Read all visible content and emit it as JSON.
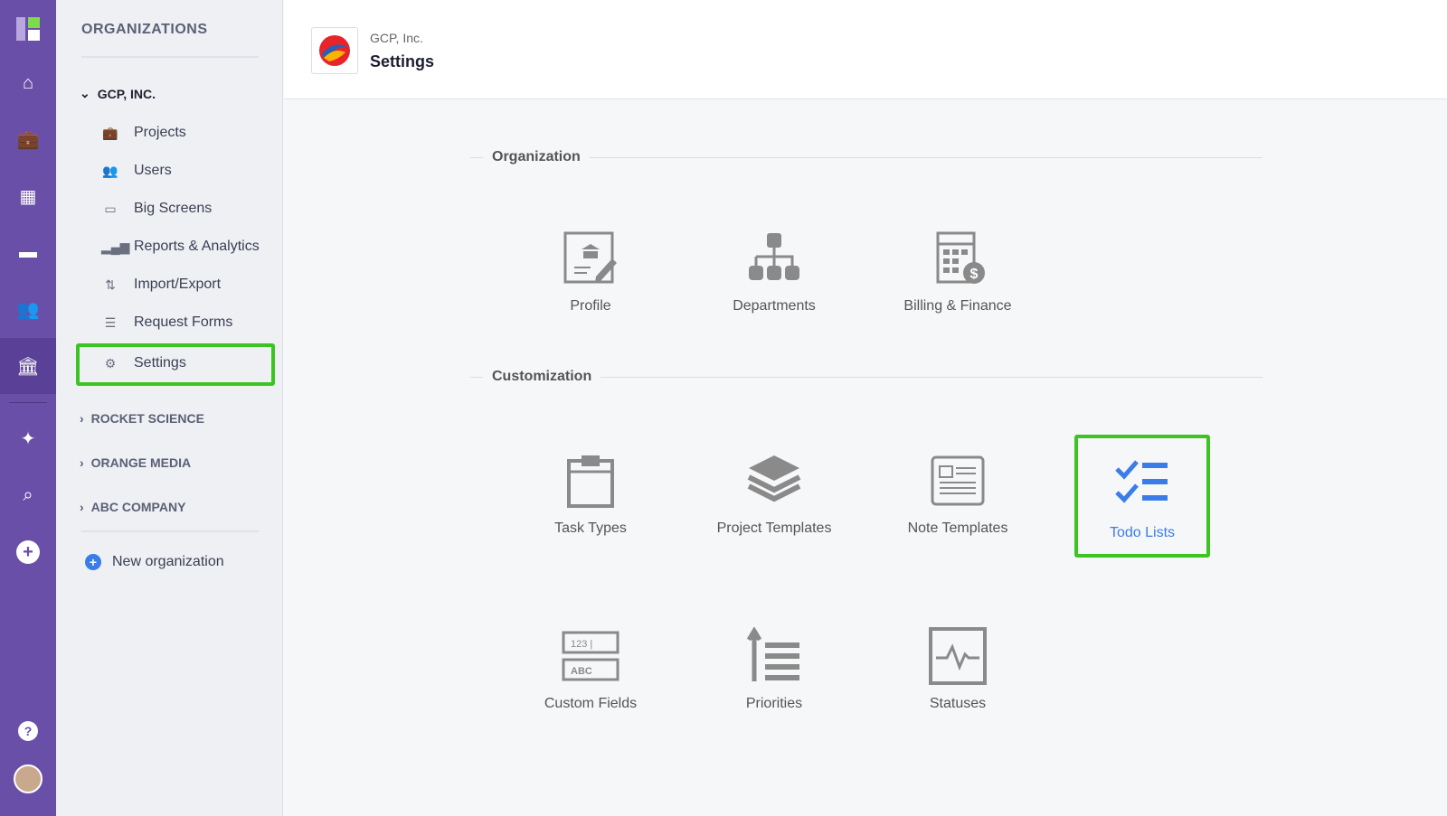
{
  "rail": {
    "items": [
      "home-icon",
      "briefcase-icon",
      "dashboard-icon",
      "chat-icon",
      "users-icon",
      "bank-icon",
      "wand-icon",
      "search-icon",
      "plus-icon",
      "help-icon",
      "avatar"
    ]
  },
  "sidebar": {
    "heading": "ORGANIZATIONS",
    "orgs": [
      {
        "name": "GCP, INC.",
        "expanded": true
      },
      {
        "name": "ROCKET SCIENCE"
      },
      {
        "name": "ORANGE MEDIA"
      },
      {
        "name": "ABC COMPANY"
      }
    ],
    "items": [
      {
        "label": "Projects",
        "icon": "briefcase-icon"
      },
      {
        "label": "Users",
        "icon": "users-icon"
      },
      {
        "label": "Big Screens",
        "icon": "screen-icon"
      },
      {
        "label": "Reports & Analytics",
        "icon": "bar-chart-icon"
      },
      {
        "label": "Import/Export",
        "icon": "arrows-icon"
      },
      {
        "label": "Request Forms",
        "icon": "form-icon"
      },
      {
        "label": "Settings",
        "icon": "gear-icon",
        "active": true
      }
    ],
    "new_org": "New organization"
  },
  "header": {
    "breadcrumb": "GCP, Inc.",
    "title": "Settings"
  },
  "sections": [
    {
      "title": "Organization",
      "tiles": [
        "Profile",
        "Departments",
        "Billing & Finance"
      ]
    },
    {
      "title": "Customization",
      "tiles": [
        "Task Types",
        "Project Templates",
        "Note Templates",
        "Todo Lists",
        "Custom Fields",
        "Priorities",
        "Statuses"
      ]
    }
  ],
  "colors": {
    "rail": "#6a4fa8",
    "highlight": "#3cc422",
    "accent": "#3b7de8"
  }
}
